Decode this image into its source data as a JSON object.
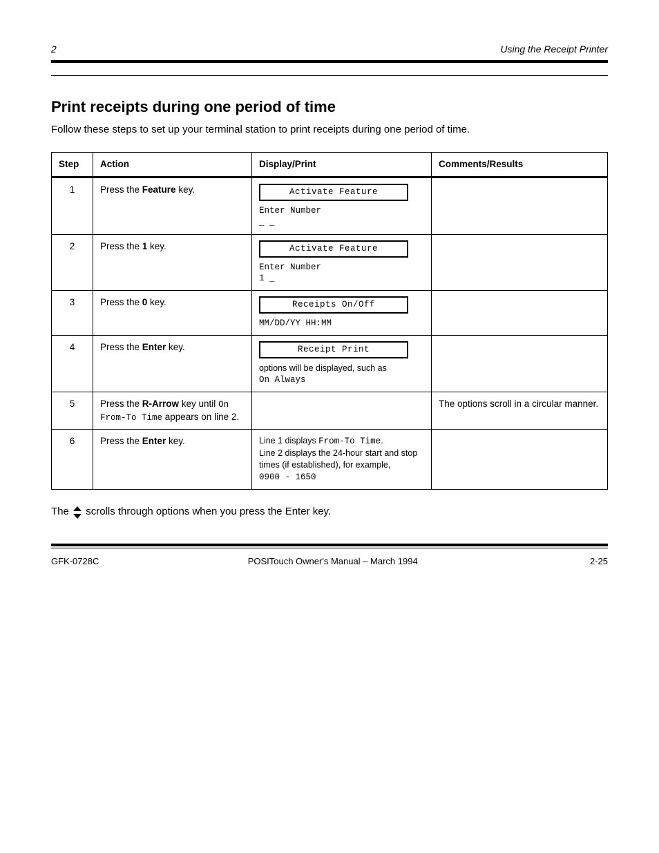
{
  "header": {
    "chapnum": "2",
    "chaptitle": "Using the Receipt Printer"
  },
  "section": {
    "title": "Print receipts during one period of time",
    "sub": "Follow these steps to set up your terminal station to print receipts during one period of time."
  },
  "table": {
    "headers": [
      "Step",
      "Action",
      "Display/Print",
      "Comments/Results"
    ],
    "rows": [
      {
        "step": "1",
        "action_html": "Press the <span class=\"key\">Feature</span> key.",
        "display": {
          "lcd": "Activate Feature",
          "below": "",
          "mono_lines": [
            "Enter Number",
            "_ _"
          ]
        },
        "comments": ""
      },
      {
        "step": "2",
        "action_html": "Press the <span class=\"key\">1</span> key.",
        "display": {
          "lcd": "Activate Feature",
          "below": "",
          "mono_lines": [
            "Enter Number",
            "1 _"
          ]
        },
        "comments": ""
      },
      {
        "step": "3",
        "action_html": "Press the <span class=\"key\">0</span> key.",
        "display": {
          "lcd": "Receipts On/Off",
          "below": "",
          "mono_lines": [
            "MM/DD/YY   HH:MM"
          ]
        },
        "comments": ""
      },
      {
        "step": "4",
        "action_html": "Press the <span class=\"key\">Enter</span> key.",
        "display": {
          "lcd": "Receipt Print",
          "below": "options will be displayed, such as",
          "mono_lines": [
            "On Always"
          ]
        },
        "comments": ""
      },
      {
        "step": "5",
        "action_html": "Press the <span class=\"key\">R-Arrow</span> key until <span class=\"mono\">On From-To Time</span> appears on line 2.",
        "display": {
          "text": ""
        },
        "comments": "The options scroll in a circular manner."
      },
      {
        "step": "6",
        "action_html": "Press the <span class=\"key\">Enter</span> key.",
        "display": {
          "text_lines": [
            "Line 1 displays <span class=\"mono\">From-To Time</span>.",
            "Line 2 displays the 24-hour start and stop times (if established), for example,",
            "<span class=\"mono\">0900 - 1650</span>"
          ]
        },
        "comments": ""
      }
    ]
  },
  "note": {
    "prefix": "The",
    "suffix": "scrolls through options when you press the Enter key."
  },
  "footer": {
    "docid": "GFK-0728C",
    "title": "POSITouch Owner's Manual – March 1994",
    "page": "2-25"
  }
}
